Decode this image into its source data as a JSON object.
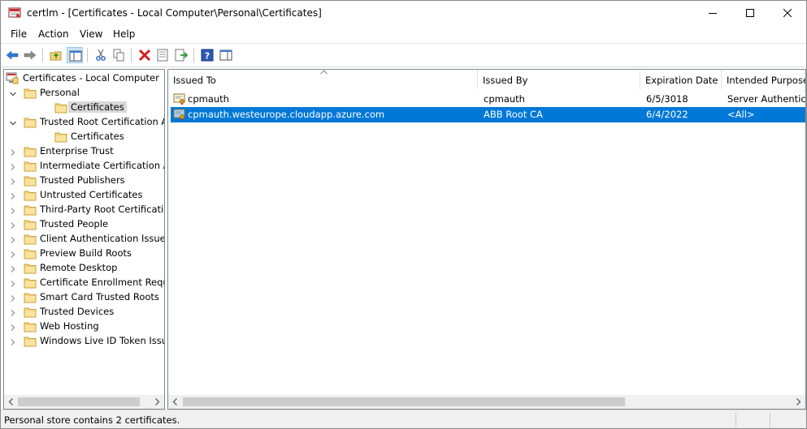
{
  "window": {
    "title": "certlm - [Certificates - Local Computer\\Personal\\Certificates]"
  },
  "menu": [
    "File",
    "Action",
    "View",
    "Help"
  ],
  "toolbar": {
    "icons": [
      "back-icon",
      "forward-icon",
      "up-folder-icon",
      "show-hide-tree-icon",
      "cut-icon",
      "copy-icon",
      "delete-icon",
      "properties-icon",
      "export-list-icon",
      "help-icon",
      "show-hide-action-pane-icon"
    ]
  },
  "tree": {
    "root": "Certificates - Local Computer",
    "items": [
      {
        "label": "Personal",
        "expanded": true
      },
      {
        "label": "Certificates",
        "child": true,
        "selected": true
      },
      {
        "label": "Trusted Root Certification Au",
        "expanded": true
      },
      {
        "label": "Certificates",
        "child": true
      },
      {
        "label": "Enterprise Trust"
      },
      {
        "label": "Intermediate Certification Au"
      },
      {
        "label": "Trusted Publishers"
      },
      {
        "label": "Untrusted Certificates"
      },
      {
        "label": "Third-Party Root Certification"
      },
      {
        "label": "Trusted People"
      },
      {
        "label": "Client Authentication Issuers"
      },
      {
        "label": "Preview Build Roots"
      },
      {
        "label": "Remote Desktop"
      },
      {
        "label": "Certificate Enrollment Reque:"
      },
      {
        "label": "Smart Card Trusted Roots"
      },
      {
        "label": "Trusted Devices"
      },
      {
        "label": "Web Hosting"
      },
      {
        "label": "Windows Live ID Token Issuer"
      }
    ]
  },
  "list": {
    "columns": [
      "Issued To",
      "Issued By",
      "Expiration Date",
      "Intended Purposes"
    ],
    "rows": [
      {
        "issued_to": "cpmauth",
        "issued_by": "cpmauth",
        "expiration": "6/5/3018",
        "purposes": "Server Authenticat",
        "selected": false
      },
      {
        "issued_to": "cpmauth.westeurope.cloudapp.azure.com",
        "issued_by": "ABB Root CA",
        "expiration": "6/4/2022",
        "purposes": "<All>",
        "selected": true
      }
    ]
  },
  "status": {
    "text": "Personal store contains 2 certificates."
  },
  "colors": {
    "selection": "#0078d7",
    "folder": "#f5d27a"
  }
}
